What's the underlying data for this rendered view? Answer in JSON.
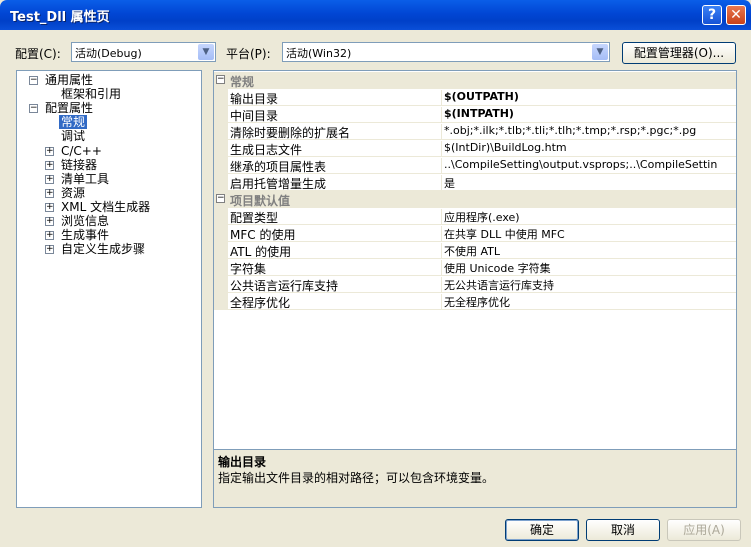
{
  "window": {
    "title": "Test_Dll 属性页",
    "help_glyph": "?",
    "close_glyph": "✕"
  },
  "toolbar": {
    "config_label": "配置(C):",
    "config_value": "活动(Debug)",
    "platform_label": "平台(P):",
    "platform_value": "活动(Win32)",
    "config_manager_label": "配置管理器(O)..."
  },
  "tree": {
    "items": [
      {
        "label": "通用属性",
        "expander": "−"
      },
      {
        "label": "框架和引用"
      },
      {
        "label": "配置属性",
        "expander": "−"
      },
      {
        "label": "常规",
        "selected": true
      },
      {
        "label": "调试"
      },
      {
        "label": "C/C++",
        "expander": "+"
      },
      {
        "label": "链接器",
        "expander": "+"
      },
      {
        "label": "清单工具",
        "expander": "+"
      },
      {
        "label": "资源",
        "expander": "+"
      },
      {
        "label": "XML 文档生成器",
        "expander": "+"
      },
      {
        "label": "浏览信息",
        "expander": "+"
      },
      {
        "label": "生成事件",
        "expander": "+"
      },
      {
        "label": "自定义生成步骤",
        "expander": "+"
      }
    ]
  },
  "grid": {
    "categories": [
      {
        "name": "常规",
        "expander": "−",
        "rows": [
          {
            "name": "输出目录",
            "value": "$(OUTPATH)",
            "bold": true
          },
          {
            "name": "中间目录",
            "value": "$(INTPATH)",
            "bold": true
          },
          {
            "name": "清除时要删除的扩展名",
            "value": "*.obj;*.ilk;*.tlb;*.tli;*.tlh;*.tmp;*.rsp;*.pgc;*.pg"
          },
          {
            "name": "生成日志文件",
            "value": "$(IntDir)\\BuildLog.htm"
          },
          {
            "name": "继承的项目属性表",
            "value": "..\\CompileSetting\\output.vsprops;..\\CompileSettin"
          },
          {
            "name": "启用托管增量生成",
            "value": "是"
          }
        ]
      },
      {
        "name": "项目默认值",
        "expander": "−",
        "rows": [
          {
            "name": "配置类型",
            "value": "应用程序(.exe)"
          },
          {
            "name": "MFC 的使用",
            "value": "在共享 DLL 中使用 MFC"
          },
          {
            "name": "ATL 的使用",
            "value": "不使用 ATL"
          },
          {
            "name": "字符集",
            "value": "使用 Unicode 字符集"
          },
          {
            "name": "公共语言运行库支持",
            "value": "无公共语言运行库支持"
          },
          {
            "name": "全程序优化",
            "value": "无全程序优化"
          }
        ]
      }
    ]
  },
  "description": {
    "title": "输出目录",
    "text": "指定输出文件目录的相对路径；可以包含环境变量。"
  },
  "buttons": {
    "ok": "确定",
    "cancel": "取消",
    "apply": "应用(A)"
  }
}
